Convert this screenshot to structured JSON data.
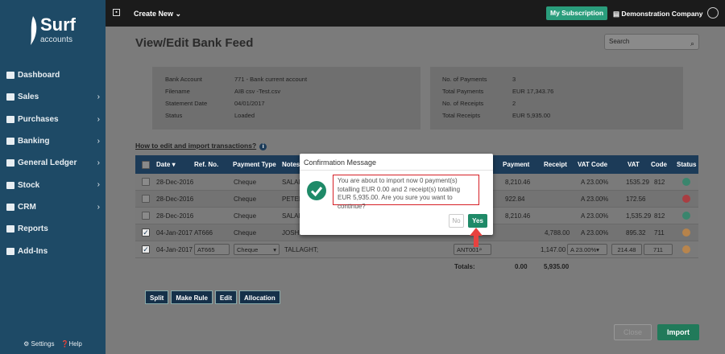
{
  "brand": {
    "name": "Surf",
    "sub": "accounts"
  },
  "sidebar": {
    "items": [
      {
        "label": "Dashboard",
        "icon": "dashboard-icon",
        "has_children": false
      },
      {
        "label": "Sales",
        "icon": "sales-icon",
        "has_children": true
      },
      {
        "label": "Purchases",
        "icon": "purchases-icon",
        "has_children": true
      },
      {
        "label": "Banking",
        "icon": "banking-icon",
        "has_children": true
      },
      {
        "label": "General Ledger",
        "icon": "ledger-icon",
        "has_children": true
      },
      {
        "label": "Stock",
        "icon": "stock-icon",
        "has_children": true
      },
      {
        "label": "CRM",
        "icon": "crm-icon",
        "has_children": true
      },
      {
        "label": "Reports",
        "icon": "reports-icon",
        "has_children": false
      },
      {
        "label": "Add-Ins",
        "icon": "addins-icon",
        "has_children": false
      }
    ],
    "settings_label": "Settings",
    "help_label": "Help"
  },
  "topbar": {
    "create_new": "Create New",
    "subscription": "My Subscription",
    "company": "Demonstration Company"
  },
  "page": {
    "title": "View/Edit Bank Feed",
    "search_placeholder": "Search"
  },
  "info_left": [
    {
      "k": "Bank Account",
      "v": "771 - Bank current account"
    },
    {
      "k": "Filename",
      "v": "AIB csv -Test.csv"
    },
    {
      "k": "Statement Date",
      "v": "04/01/2017"
    },
    {
      "k": "Status",
      "v": "Loaded"
    }
  ],
  "info_right": [
    {
      "k": "No. of Payments",
      "v": "3"
    },
    {
      "k": "Total Payments",
      "v": "EUR 17,343.76"
    },
    {
      "k": "No. of Receipts",
      "v": "2"
    },
    {
      "k": "Total Receipts",
      "v": "EUR 5,935.00"
    }
  ],
  "howto": "How to edit and import transactions?",
  "table": {
    "headers": [
      "Date ▾",
      "Ref. No.",
      "Payment Type",
      "Notes",
      "Payment",
      "Receipt",
      "VAT Code",
      "VAT",
      "Code",
      "Status"
    ],
    "rows": [
      {
        "checked": false,
        "date": "28-Dec-2016",
        "ref": "",
        "ptype": "Cheque",
        "notes": "SALAR",
        "payment": "8,210.46",
        "receipt": "",
        "vatcode": "A 23.00%",
        "vat": "1535.29",
        "code": "812",
        "status": "#1f8a68"
      },
      {
        "checked": false,
        "date": "28-Dec-2016",
        "ref": "",
        "ptype": "Cheque",
        "notes": "PETER",
        "payment": "922.84",
        "receipt": "",
        "vatcode": "A 23.00%",
        "vat": "172.56",
        "code": "",
        "status": "#c0282e"
      },
      {
        "checked": false,
        "date": "28-Dec-2016",
        "ref": "",
        "ptype": "Cheque",
        "notes": "SALAR",
        "payment": "8,210.46",
        "receipt": "",
        "vatcode": "A 23.00%",
        "vat": "1,535.29",
        "code": "812",
        "status": "#1f8a68"
      },
      {
        "checked": true,
        "date": "04-Jan-2017",
        "ref": "AT666",
        "ptype": "Cheque",
        "notes": "JOSHUA",
        "payment": "",
        "receipt": "4,788.00",
        "vatcode": "A 23.00%",
        "vat": "895.32",
        "code": "711",
        "status": "#d38a3a"
      },
      {
        "checked": true,
        "date": "04-Jan-2017",
        "ref": "AT665",
        "ptype": "Cheque",
        "notes": "TALLAGHT;",
        "account": "ANT001",
        "payment": "",
        "receipt": "1,147.00",
        "vatcode": "A 23.00%",
        "vat": "214.48",
        "code": "711",
        "status": "#d38a3a"
      }
    ],
    "totals_label": "Totals:",
    "totals_payment": "0.00",
    "totals_receipt": "5,935.00"
  },
  "actions": [
    "Split",
    "Make Rule",
    "Edit",
    "Allocation"
  ],
  "close_label": "Close",
  "import_label": "Import",
  "modal": {
    "title": "Confirmation Message",
    "message": "You are about to import now 0 payment(s) totalling EUR 0.00 and 2 receipt(s) totalling EUR 5,935.00. Are you sure you want to continue?",
    "no": "No",
    "yes": "Yes"
  },
  "colors": {
    "sidebar": "#1e4a66",
    "accent": "#1f8a68",
    "header": "#1c3b58",
    "highlight": "#d61f26"
  }
}
